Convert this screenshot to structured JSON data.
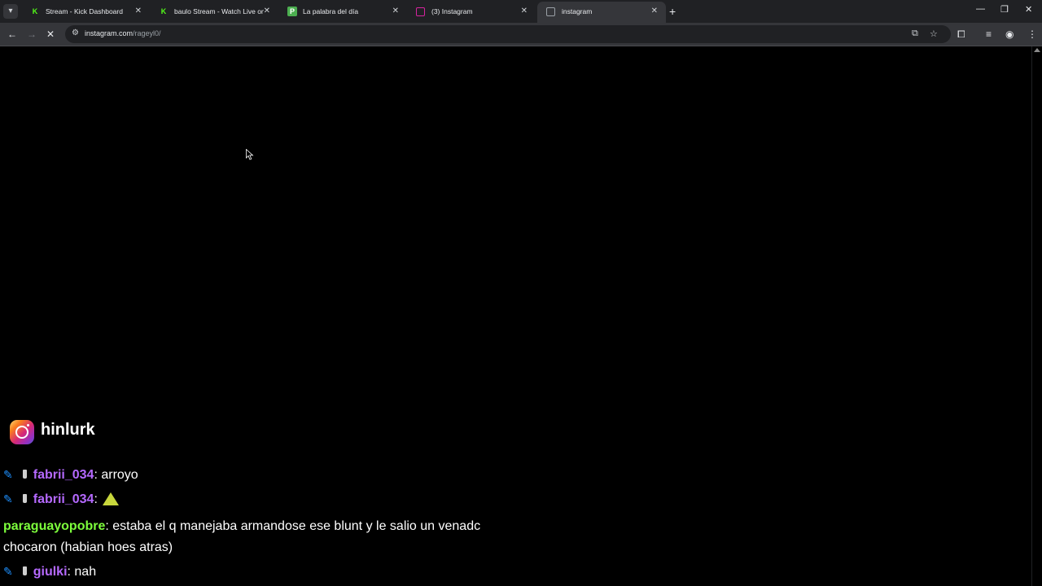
{
  "tabs": [
    {
      "title": "Stream - Kick Dashboard",
      "favicon": "kick-icon",
      "active": false
    },
    {
      "title": "baulo Stream - Watch Live on K",
      "favicon": "kick-icon",
      "active": false
    },
    {
      "title": "La palabra del día",
      "favicon": "p-icon",
      "active": false
    },
    {
      "title": "(3) Instagram",
      "favicon": "instagram-icon",
      "active": false
    },
    {
      "title": "instagram",
      "favicon": "globe-icon",
      "active": true
    }
  ],
  "address_bar": {
    "host": "instagram.com",
    "path": "/rageyl0/"
  },
  "overlay": {
    "handle": "hinlurk",
    "chat": [
      {
        "user": "fabrii_034",
        "message": "arroyo",
        "color": "#b569ff"
      },
      {
        "user": "fabrii_034",
        "message": "",
        "color": "#b569ff"
      },
      {
        "user": "paraguayopobre",
        "message": "estaba el q manejaba armandose ese blunt y le salio un venadc",
        "continuation": "chocaron (habian hoes atras)",
        "color": "#7dff3c"
      },
      {
        "user": "giulki",
        "message": "nah",
        "color": "#b569ff"
      }
    ]
  },
  "colors": {
    "tabstrip": "#202124",
    "toolbar": "#35363a",
    "page_bg": "#000000"
  }
}
